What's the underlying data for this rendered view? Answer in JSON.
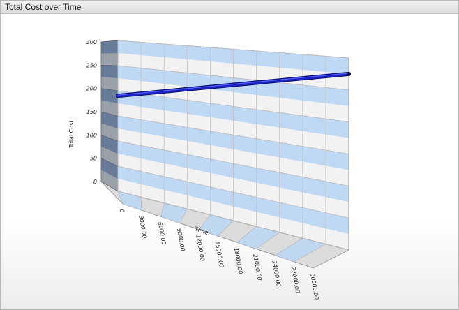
{
  "window": {
    "title": "Total Cost over Time"
  },
  "chart_data": {
    "type": "line",
    "title": "Total Cost over Time",
    "xlabel": "Time",
    "ylabel": "Total Cost",
    "xlim": [
      0,
      30000
    ],
    "ylim": [
      0,
      300
    ],
    "x_ticks": [
      "0",
      "3000.00",
      "6000.00",
      "9000.00",
      "12000.00",
      "15000.00",
      "18000.00",
      "21000.00",
      "24000.00",
      "27000.00",
      "30000.00"
    ],
    "y_ticks": [
      "0",
      "50",
      "100",
      "150",
      "200",
      "250",
      "300"
    ],
    "grid": true,
    "three_d": true,
    "series": [
      {
        "x": [
          0,
          30000
        ],
        "y": [
          190,
          275
        ],
        "color": "#1a23c8"
      }
    ],
    "colors": {
      "band": "#bcd6f3",
      "wall": "#f2f2f2",
      "side_wall": "#9aa0a8",
      "line": "#1a23c8"
    }
  }
}
